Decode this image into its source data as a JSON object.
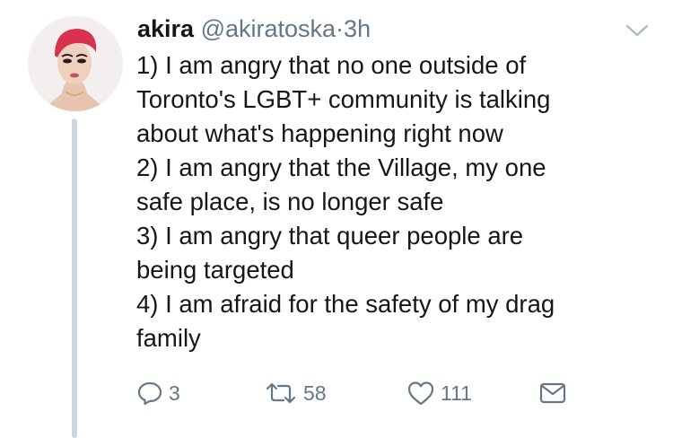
{
  "tweet": {
    "author_name": "akira",
    "author_handle": "@akiratoska",
    "separator": "·",
    "timestamp": "3h",
    "lines": [
      "1) I am angry that no one outside of",
      "Toronto's LGBT+ community is talking",
      "about what's happening right now",
      "2) I am angry that the Village, my one",
      "safe place, is no longer safe",
      "3) I am angry that queer people are",
      "being targeted",
      "4) I am afraid for the safety of my drag",
      "family"
    ]
  },
  "actions": {
    "reply_count": "3",
    "retweet_count": "58",
    "like_count": "111"
  },
  "icons": {
    "reply": "reply-icon",
    "retweet": "retweet-icon",
    "like": "heart-icon",
    "dm": "envelope-icon",
    "menu": "chevron-down-icon"
  },
  "colors": {
    "text": "#14171a",
    "muted": "#657786",
    "thread_line": "#ccd6dd",
    "avatar_hair": "#d8324f"
  }
}
